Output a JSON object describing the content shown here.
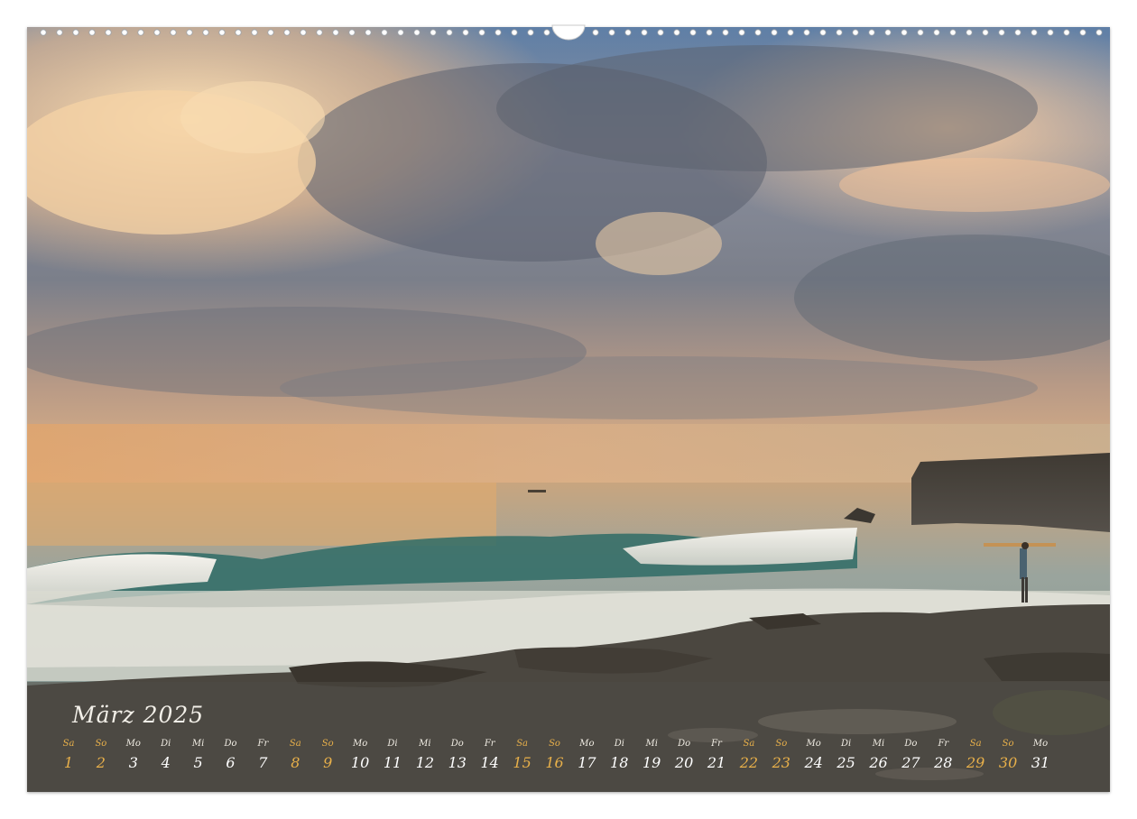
{
  "calendar": {
    "month_title": "März 2025",
    "weekend_color": "#e8b04a",
    "text_color": "#ffffff",
    "days": [
      {
        "abbr": "Sa",
        "num": "1",
        "weekend": true
      },
      {
        "abbr": "So",
        "num": "2",
        "weekend": true
      },
      {
        "abbr": "Mo",
        "num": "3",
        "weekend": false
      },
      {
        "abbr": "Di",
        "num": "4",
        "weekend": false
      },
      {
        "abbr": "Mi",
        "num": "5",
        "weekend": false
      },
      {
        "abbr": "Do",
        "num": "6",
        "weekend": false
      },
      {
        "abbr": "Fr",
        "num": "7",
        "weekend": false
      },
      {
        "abbr": "Sa",
        "num": "8",
        "weekend": true
      },
      {
        "abbr": "So",
        "num": "9",
        "weekend": true
      },
      {
        "abbr": "Mo",
        "num": "10",
        "weekend": false
      },
      {
        "abbr": "Di",
        "num": "11",
        "weekend": false
      },
      {
        "abbr": "Mi",
        "num": "12",
        "weekend": false
      },
      {
        "abbr": "Do",
        "num": "13",
        "weekend": false
      },
      {
        "abbr": "Fr",
        "num": "14",
        "weekend": false
      },
      {
        "abbr": "Sa",
        "num": "15",
        "weekend": true
      },
      {
        "abbr": "So",
        "num": "16",
        "weekend": true
      },
      {
        "abbr": "Mo",
        "num": "17",
        "weekend": false
      },
      {
        "abbr": "Di",
        "num": "18",
        "weekend": false
      },
      {
        "abbr": "Mi",
        "num": "19",
        "weekend": false
      },
      {
        "abbr": "Do",
        "num": "20",
        "weekend": false
      },
      {
        "abbr": "Fr",
        "num": "21",
        "weekend": false
      },
      {
        "abbr": "Sa",
        "num": "22",
        "weekend": true
      },
      {
        "abbr": "So",
        "num": "23",
        "weekend": true
      },
      {
        "abbr": "Mo",
        "num": "24",
        "weekend": false
      },
      {
        "abbr": "Di",
        "num": "25",
        "weekend": false
      },
      {
        "abbr": "Mi",
        "num": "26",
        "weekend": false
      },
      {
        "abbr": "Do",
        "num": "27",
        "weekend": false
      },
      {
        "abbr": "Fr",
        "num": "28",
        "weekend": false
      },
      {
        "abbr": "Sa",
        "num": "29",
        "weekend": true
      },
      {
        "abbr": "So",
        "num": "30",
        "weekend": true
      },
      {
        "abbr": "Mo",
        "num": "31",
        "weekend": false
      }
    ]
  }
}
